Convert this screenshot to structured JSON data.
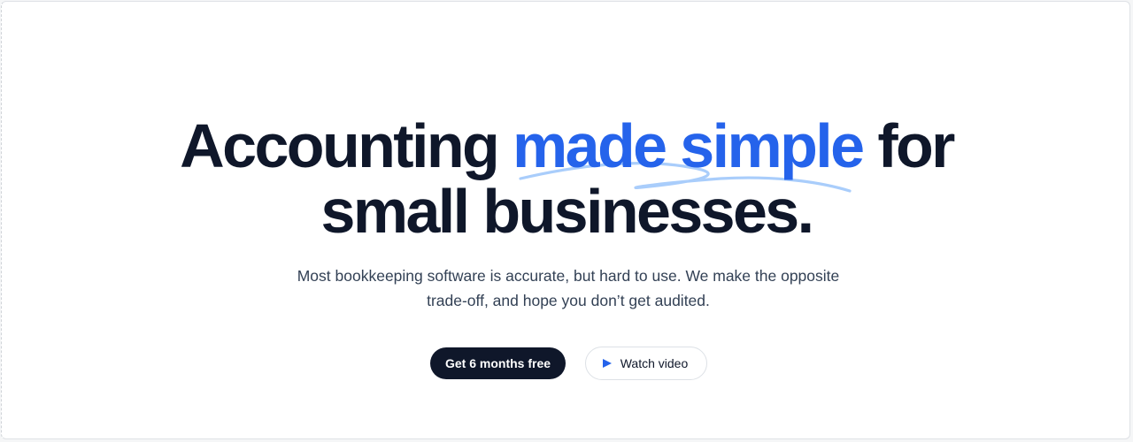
{
  "hero": {
    "headline_part1": "Accounting ",
    "headline_accent": "made simple",
    "headline_part2": " for",
    "headline_line2": "small businesses.",
    "subheading": "Most bookkeeping software is accurate, but hard to use. We make the opposite trade-off, and hope you don’t get audited."
  },
  "actions": {
    "primary_label": "Get 6 months free",
    "secondary_label": "Watch video",
    "secondary_icon": "play-icon"
  },
  "colors": {
    "text": "#0f172a",
    "accent": "#2563eb",
    "scribble": "#93c5fd",
    "muted": "#334155"
  }
}
